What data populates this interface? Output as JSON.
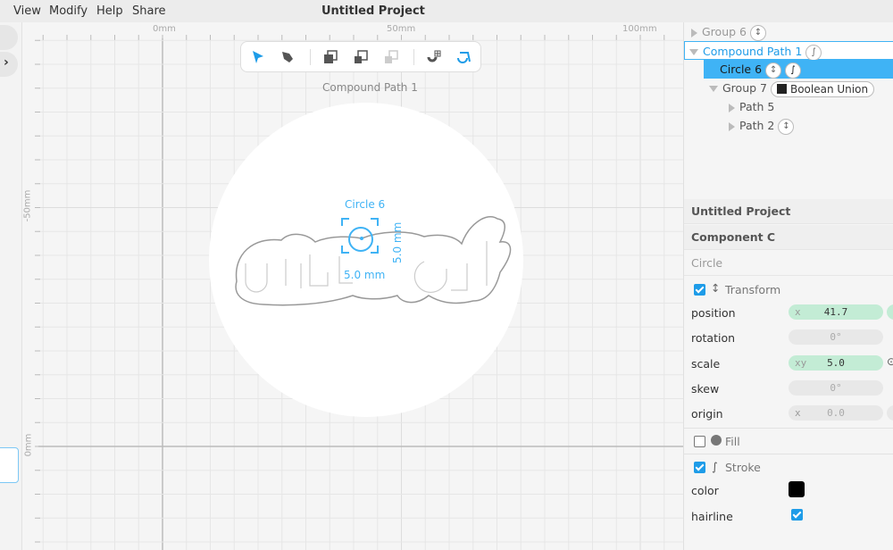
{
  "menu": {
    "items": [
      "View",
      "Modify",
      "Help",
      "Share"
    ],
    "title": "Untitled Project"
  },
  "ruler": {
    "x_labels": [
      "0mm",
      "50mm",
      "100mm"
    ],
    "y_labels": [
      "-50mm",
      "0mm"
    ]
  },
  "toolbar": {
    "tools": [
      "select-arrow",
      "pen",
      "bring-forward",
      "send-backward",
      "disabled-transform",
      "snap-grid",
      "edit-path"
    ]
  },
  "canvas": {
    "selection_label": "Compound Path 1",
    "circle_label": "Circle 6",
    "width_dim": "5.0 mm",
    "height_dim": "5.0 mm"
  },
  "tree": [
    {
      "label": "Group 6",
      "badge": "transform-icon"
    },
    {
      "label": "Compound Path 1",
      "badge": "stroke-icon"
    },
    {
      "label": "Circle 6",
      "badge": "transform-icon"
    },
    {
      "label": "Group 7",
      "badge_text": "Boolean Union"
    },
    {
      "label": "Path 5"
    },
    {
      "label": "Path 2",
      "badge": "transform-icon"
    }
  ],
  "inspector": {
    "project": "Untitled Project",
    "component": "Component C",
    "type": "Circle",
    "transform": {
      "label": "Transform",
      "enabled": true,
      "position_label": "position",
      "position_axis": "x",
      "position_x": "41.7",
      "rotation_label": "rotation",
      "rotation": "0°",
      "scale_label": "scale",
      "scale_axis": "xy",
      "scale": "5.0",
      "skew_label": "skew",
      "skew": "0°",
      "origin_label": "origin",
      "origin_axis": "x",
      "origin_x": "0.0"
    },
    "fill": {
      "label": "Fill",
      "enabled": false
    },
    "stroke": {
      "label": "Stroke",
      "enabled": true,
      "color_label": "color",
      "color": "#000000",
      "hairline_label": "hairline",
      "hairline": true
    }
  },
  "colors": {
    "accent": "#1e9ce8",
    "selection": "#3fb3f5",
    "field_green": "#c3ecd5"
  }
}
